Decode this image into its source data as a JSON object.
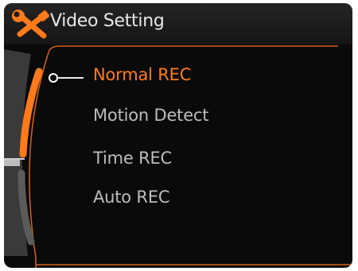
{
  "header": {
    "title": "Video Setting",
    "icon": "wrench-screwdriver-icon"
  },
  "menu": {
    "selected_index": 0,
    "items": [
      {
        "label": "Normal REC",
        "selected": true
      },
      {
        "label": "Motion Detect",
        "selected": false
      },
      {
        "label": "Time REC",
        "selected": false
      },
      {
        "label": "Auto REC",
        "selected": false
      }
    ]
  },
  "colors": {
    "accent": "#ff7a1a",
    "text": "#bdbdbd",
    "background": "#0a0a0a"
  }
}
